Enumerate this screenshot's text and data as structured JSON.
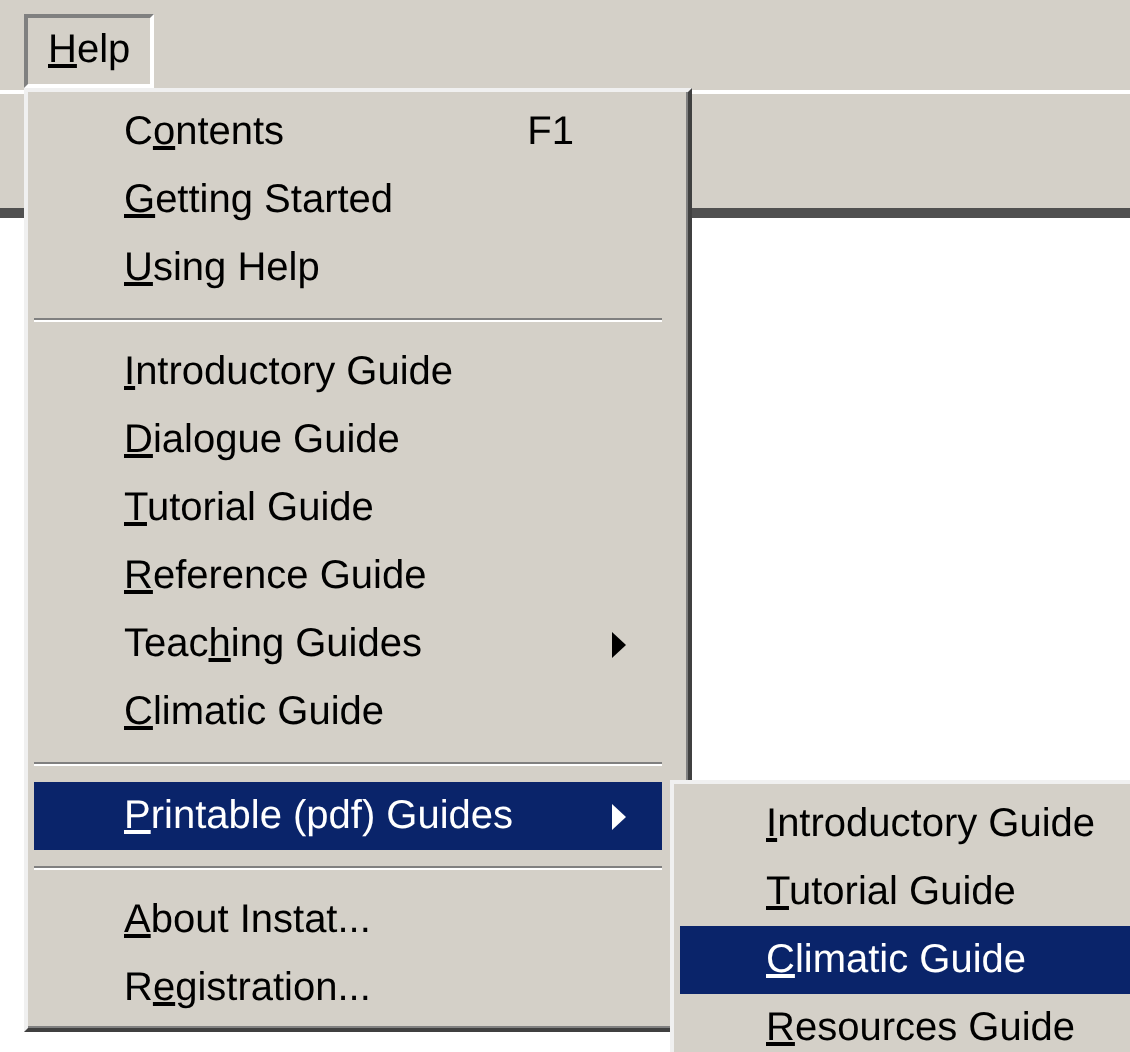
{
  "menubar": [
    {
      "key": "H",
      "after": "elp",
      "selected": true
    }
  ],
  "menu": [
    {
      "kind": "item",
      "before": "C",
      "key": "o",
      "after": "ntents",
      "shortcut": "F1",
      "selected": false
    },
    {
      "kind": "item",
      "key": "G",
      "after": "etting Started",
      "selected": false
    },
    {
      "kind": "item",
      "key": "U",
      "after": "sing Help",
      "selected": false
    },
    {
      "kind": "separator"
    },
    {
      "kind": "item",
      "key": "I",
      "after": "ntroductory Guide",
      "selected": false
    },
    {
      "kind": "item",
      "key": "D",
      "after": "ialogue Guide",
      "selected": false
    },
    {
      "kind": "item",
      "key": "T",
      "after": "utorial Guide",
      "selected": false
    },
    {
      "kind": "item",
      "key": "R",
      "after": "eference Guide",
      "selected": false
    },
    {
      "kind": "submenu",
      "before": "Teac",
      "key": "h",
      "after": "ing Guides",
      "selected": false
    },
    {
      "kind": "item",
      "key": "C",
      "after": "limatic Guide",
      "selected": false
    },
    {
      "kind": "separator"
    },
    {
      "kind": "submenu",
      "key": "P",
      "after": "rintable (pdf) Guides",
      "selected": true
    },
    {
      "kind": "separator"
    },
    {
      "kind": "item",
      "key": "A",
      "after": "bout Instat...",
      "selected": false
    },
    {
      "kind": "item",
      "before": "R",
      "key": "e",
      "after": "gistration...",
      "selected": false
    }
  ],
  "submenu": [
    {
      "kind": "item",
      "key": "I",
      "after": "ntroductory Guide",
      "selected": false
    },
    {
      "kind": "item",
      "key": "T",
      "after": "utorial Guide",
      "selected": false
    },
    {
      "kind": "item",
      "key": "C",
      "after": "limatic Guide",
      "selected": true
    },
    {
      "kind": "item",
      "key": "R",
      "after": "esources Guide",
      "selected": false
    }
  ]
}
